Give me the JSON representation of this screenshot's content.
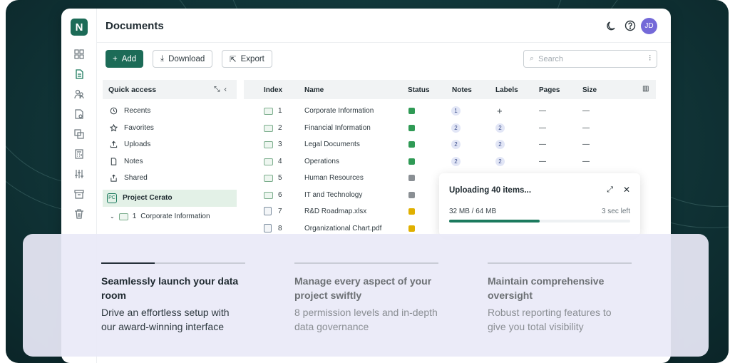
{
  "app": {
    "logo": "N",
    "title": "Documents",
    "avatar_initials": "JD"
  },
  "toolbar": {
    "add_label": "Add",
    "download_label": "Download",
    "export_label": "Export",
    "search_placeholder": "Search"
  },
  "quick_access": {
    "title": "Quick access",
    "items": [
      {
        "label": "Recents",
        "icon": "history-icon"
      },
      {
        "label": "Favorites",
        "icon": "star-icon"
      },
      {
        "label": "Uploads",
        "icon": "upload-icon"
      },
      {
        "label": "Notes",
        "icon": "note-icon"
      },
      {
        "label": "Shared",
        "icon": "share-icon"
      }
    ],
    "project": {
      "badge": "PC",
      "label": "Project Cerato"
    },
    "tree": [
      {
        "index": "1",
        "label": "Corporate Information"
      }
    ]
  },
  "table": {
    "headers": {
      "index": "Index",
      "name": "Name",
      "status": "Status",
      "notes": "Notes",
      "labels": "Labels",
      "pages": "Pages",
      "size": "Size"
    },
    "rows": [
      {
        "type": "folder",
        "index": "1",
        "name": "Corporate Information",
        "status": "green",
        "notes": "1",
        "labels": "+",
        "pages": "—",
        "size": "—"
      },
      {
        "type": "folder",
        "index": "2",
        "name": "Financial Information",
        "status": "green",
        "notes": "2",
        "labels": "2",
        "pages": "—",
        "size": "—"
      },
      {
        "type": "folder",
        "index": "3",
        "name": "Legal Documents",
        "status": "green",
        "notes": "2",
        "labels": "2",
        "pages": "—",
        "size": "—"
      },
      {
        "type": "folder",
        "index": "4",
        "name": "Operations",
        "status": "green",
        "notes": "2",
        "labels": "2",
        "pages": "—",
        "size": "—"
      },
      {
        "type": "folder",
        "index": "5",
        "name": "Human Resources",
        "status": "gray"
      },
      {
        "type": "folder",
        "index": "6",
        "name": "IT and Technology",
        "status": "gray"
      },
      {
        "type": "file",
        "index": "7",
        "name": "R&D Roadmap.xlsx",
        "status": "yellow"
      },
      {
        "type": "file",
        "index": "8",
        "name": "Organizational Chart.pdf",
        "status": "yellow"
      }
    ]
  },
  "upload": {
    "title": "Uploading 40 items...",
    "progress_text": "32 MB / 64 MB",
    "time_left": "3 sec left",
    "progress": 0.5
  },
  "features": [
    {
      "title": "Seamlessly launch your data room",
      "desc": "Drive an effortless setup with our award-winning interface",
      "active": true
    },
    {
      "title": "Manage every aspect of your project swiftly",
      "desc": "8 permission levels and in-depth data governance",
      "active": false
    },
    {
      "title": "Maintain comprehensive oversight",
      "desc": "Robust reporting features to give you total visibility",
      "active": false
    }
  ],
  "colors": {
    "brand": "#1c6b57",
    "accent_green": "#1c7a5e",
    "avatar": "#7469d8",
    "status_green": "#2f9a55",
    "status_yellow": "#e0b000",
    "status_gray": "#8a8f94"
  }
}
